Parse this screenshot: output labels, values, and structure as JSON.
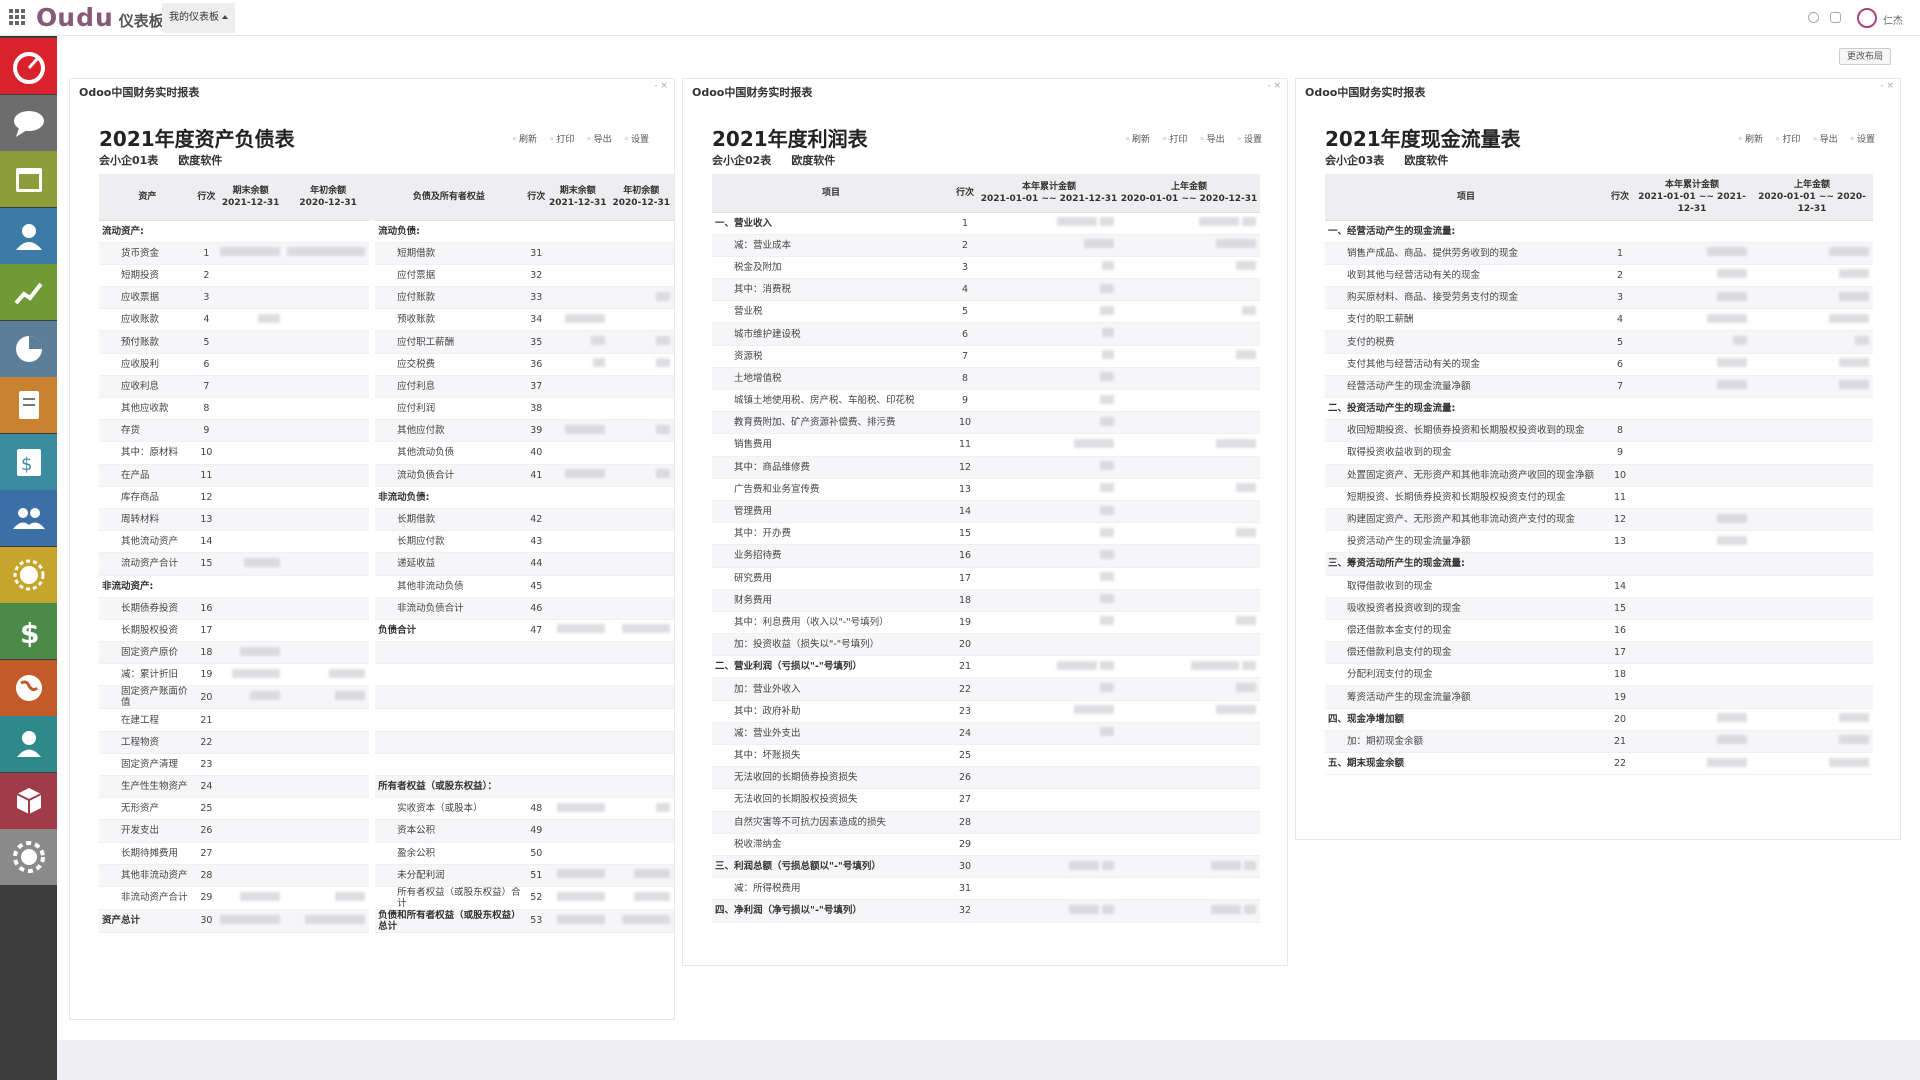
{
  "topbar": {
    "logo_o": "O",
    "logo_rest": "udu",
    "app_name": "仪表板",
    "dashboard_menu": "我的仪表板",
    "user_name": "仁杰"
  },
  "sidebar_icons": [
    "dashboard-icon",
    "chat-icon",
    "calendar-icon",
    "contacts-icon",
    "sales-chart-icon",
    "pie-chart-icon",
    "document-icon",
    "invoice-icon",
    "employees-icon",
    "sun-icon",
    "dollar-icon",
    "website-icon",
    "user-icon",
    "inventory-icon",
    "settings-icon"
  ],
  "layout_button": "更改布局",
  "toolbar": {
    "refresh": "刷新",
    "print": "打印",
    "export": "导出",
    "settings": "设置"
  },
  "balance": {
    "panel_title": "Odoo中国财务实时报表",
    "title": "2021年度资产负债表",
    "code": "会小企01表",
    "company": "欧度软件",
    "headers": {
      "asset": "资产",
      "line": "行次",
      "end": "期末余额",
      "end_date": "2021-12-31",
      "begin": "年初余额",
      "begin_date": "2020-12-31",
      "liab": "负债及所有者权益"
    },
    "rows": [
      {
        "a": "流动资产:",
        "as": true,
        "l": "流动负债:",
        "ls": true
      },
      {
        "a": "货币资金",
        "an": "1",
        "av": [
          60,
          78
        ],
        "l": "短期借款",
        "ln": "31"
      },
      {
        "a": "短期投资",
        "an": "2",
        "l": "应付票据",
        "ln": "32"
      },
      {
        "a": "应收票据",
        "an": "3",
        "l": "应付账款",
        "ln": "33",
        "lv": [
          0,
          14
        ]
      },
      {
        "a": "应收账款",
        "an": "4",
        "av": [
          22,
          0
        ],
        "l": "预收账款",
        "ln": "34",
        "lv": [
          40,
          0
        ]
      },
      {
        "a": "预付账款",
        "an": "5",
        "l": "应付职工薪酬",
        "ln": "35",
        "lv": [
          14,
          14
        ]
      },
      {
        "a": "应收股利",
        "an": "6",
        "l": "应交税费",
        "ln": "36",
        "lv": [
          12,
          14
        ]
      },
      {
        "a": "应收利息",
        "an": "7",
        "l": "应付利息",
        "ln": "37"
      },
      {
        "a": "其他应收款",
        "an": "8",
        "l": "应付利润",
        "ln": "38"
      },
      {
        "a": "存货",
        "an": "9",
        "l": "其他应付款",
        "ln": "39",
        "lv": [
          40,
          14
        ]
      },
      {
        "a": "其中：原材料",
        "an": "10",
        "l": "其他流动负债",
        "ln": "40"
      },
      {
        "a": "在产品",
        "an": "11",
        "l": "流动负债合计",
        "ln": "41",
        "lv": [
          40,
          14
        ]
      },
      {
        "a": "库存商品",
        "an": "12",
        "l": "非流动负债:",
        "ls": true
      },
      {
        "a": "周转材料",
        "an": "13",
        "l": "长期借款",
        "ln": "42"
      },
      {
        "a": "其他流动资产",
        "an": "14",
        "l": "长期应付款",
        "ln": "43"
      },
      {
        "a": "流动资产合计",
        "an": "15",
        "av": [
          36,
          0
        ],
        "l": "递延收益",
        "ln": "44"
      },
      {
        "a": "非流动资产:",
        "as": true,
        "l": "其他非流动负债",
        "ln": "45"
      },
      {
        "a": "长期债券投资",
        "an": "16",
        "l": "非流动负债合计",
        "ln": "46"
      },
      {
        "a": "长期股权投资",
        "an": "17",
        "l": "负债合计",
        "ls": true,
        "ln": "47",
        "lv": [
          48,
          48
        ]
      },
      {
        "a": "固定资产原价",
        "an": "18",
        "av": [
          40,
          0
        ]
      },
      {
        "a": "减：累计折旧",
        "an": "19",
        "av": [
          48,
          36
        ]
      },
      {
        "a": "固定资产账面价值",
        "an": "20",
        "av": [
          30,
          30
        ]
      },
      {
        "a": "在建工程",
        "an": "21"
      },
      {
        "a": "工程物资",
        "an": "22"
      },
      {
        "a": "固定资产清理",
        "an": "23"
      },
      {
        "a": "生产性生物资产",
        "an": "24",
        "l": "所有者权益（或股东权益）：",
        "ls": true
      },
      {
        "a": "无形资产",
        "an": "25",
        "l": "实收资本（或股本）",
        "ln": "48",
        "lv": [
          48,
          14
        ]
      },
      {
        "a": "开发支出",
        "an": "26",
        "l": "资本公积",
        "ln": "49"
      },
      {
        "a": "长期待摊费用",
        "an": "27",
        "l": "盈余公积",
        "ln": "50"
      },
      {
        "a": "其他非流动资产",
        "an": "28",
        "l": "未分配利润",
        "ln": "51",
        "lv": [
          48,
          36
        ]
      },
      {
        "a": "非流动资产合计",
        "an": "29",
        "av": [
          40,
          30
        ],
        "l": "所有者权益（或股东权益）合计",
        "ln": "52",
        "lv": [
          48,
          36
        ]
      },
      {
        "a": "资产总计",
        "as": true,
        "an": "30",
        "av": [
          60,
          60
        ],
        "l": "负债和所有者权益（或股东权益）总计",
        "ls": true,
        "ln": "53",
        "lv": [
          48,
          48
        ]
      }
    ]
  },
  "profit": {
    "panel_title": "Odoo中国财务实时报表",
    "title": "2021年度利润表",
    "code": "会小企02表",
    "company": "欧度软件",
    "headers": {
      "item": "项目",
      "line": "行次",
      "cur": "本年累计金额",
      "cur_range": "2021-01-01 ~~ 2021-12-31",
      "prev": "上年金额",
      "prev_range": "2020-01-01 ~~ 2020-12-31"
    },
    "rows": [
      {
        "t": "一、营业收入",
        "s": true,
        "n": "1",
        "c": [
          40,
          14
        ],
        "p": [
          40,
          14
        ]
      },
      {
        "t": "减：营业成本",
        "n": "2",
        "c": [
          30,
          0
        ],
        "p": [
          40,
          0
        ]
      },
      {
        "t": "税金及附加",
        "n": "3",
        "c": [
          12,
          0
        ],
        "p": [
          0,
          20
        ]
      },
      {
        "t": "其中：消费税",
        "n": "4",
        "c": [
          14,
          0
        ]
      },
      {
        "t": "营业税",
        "n": "5",
        "c": [
          14,
          0
        ],
        "p": [
          0,
          14
        ]
      },
      {
        "t": "城市维护建设税",
        "n": "6",
        "c": [
          12,
          0
        ]
      },
      {
        "t": "资源税",
        "n": "7",
        "c": [
          12,
          0
        ],
        "p": [
          0,
          20
        ]
      },
      {
        "t": "土地增值税",
        "n": "8",
        "c": [
          14,
          0
        ]
      },
      {
        "t": "城镇土地使用税、房产税、车船税、印花税",
        "n": "9",
        "c": [
          14,
          0
        ]
      },
      {
        "t": "教育费附加、矿产资源补偿费、排污费",
        "n": "10",
        "c": [
          14,
          0
        ]
      },
      {
        "t": "销售费用",
        "n": "11",
        "c": [
          40,
          0
        ],
        "p": [
          40,
          0
        ]
      },
      {
        "t": "其中：商品维修费",
        "n": "12",
        "c": [
          14,
          0
        ]
      },
      {
        "t": "广告费和业务宣传费",
        "n": "13",
        "c": [
          14,
          0
        ],
        "p": [
          0,
          20
        ]
      },
      {
        "t": "管理费用",
        "n": "14",
        "c": [
          14,
          0
        ]
      },
      {
        "t": "其中：开办费",
        "n": "15",
        "c": [
          14,
          0
        ],
        "p": [
          0,
          20
        ]
      },
      {
        "t": "业务招待费",
        "n": "16",
        "c": [
          14,
          0
        ]
      },
      {
        "t": "研究费用",
        "n": "17",
        "c": [
          14,
          0
        ]
      },
      {
        "t": "财务费用",
        "n": "18",
        "c": [
          14,
          0
        ]
      },
      {
        "t": "其中：利息费用（收入以\"-\"号填列）",
        "n": "19",
        "c": [
          14,
          0
        ],
        "p": [
          0,
          20
        ]
      },
      {
        "t": "加：投资收益（损失以\"-\"号填列）",
        "n": "20"
      },
      {
        "t": "二、营业利润（亏损以\"-\"号填列）",
        "s": true,
        "n": "21",
        "c": [
          40,
          14
        ],
        "p": [
          48,
          14
        ]
      },
      {
        "t": "加：营业外收入",
        "n": "22",
        "c": [
          14,
          0
        ],
        "p": [
          0,
          20
        ]
      },
      {
        "t": "其中：政府补助",
        "n": "23",
        "c": [
          40,
          0
        ],
        "p": [
          40,
          0
        ]
      },
      {
        "t": "减：营业外支出",
        "n": "24",
        "c": [
          14,
          0
        ]
      },
      {
        "t": "其中：坏账损失",
        "n": "25"
      },
      {
        "t": "无法收回的长期债券投资损失",
        "n": "26"
      },
      {
        "t": "无法收回的长期股权投资损失",
        "n": "27"
      },
      {
        "t": "自然灾害等不可抗力因素造成的损失",
        "n": "28"
      },
      {
        "t": "税收滞纳金",
        "n": "29"
      },
      {
        "t": "三、利润总额（亏损总额以\"-\"号填列）",
        "s": true,
        "n": "30",
        "c": [
          30,
          12
        ],
        "p": [
          30,
          12
        ]
      },
      {
        "t": "减：所得税费用",
        "n": "31"
      },
      {
        "t": "四、净利润（净亏损以\"-\"号填列）",
        "s": true,
        "n": "32",
        "c": [
          30,
          12
        ],
        "p": [
          30,
          12
        ]
      }
    ]
  },
  "cashflow": {
    "panel_title": "Odoo中国财务实时报表",
    "title": "2021年度现金流量表",
    "code": "会小企03表",
    "company": "欧度软件",
    "headers": {
      "item": "项目",
      "line": "行次",
      "cur": "本年累计金额",
      "cur_range": "2021-01-01 ~~ 2021-12-31",
      "prev": "上年金额",
      "prev_range": "2020-01-01 ~~ 2020-12-31"
    },
    "rows": [
      {
        "t": "一、经营活动产生的现金流量:",
        "s": true
      },
      {
        "t": "销售产成品、商品、提供劳务收到的现金",
        "n": "1",
        "c": [
          40,
          0
        ],
        "p": [
          40,
          0
        ]
      },
      {
        "t": "收到其他与经营活动有关的现金",
        "n": "2",
        "c": [
          30,
          0
        ],
        "p": [
          30,
          0
        ]
      },
      {
        "t": "购买原材料、商品、接受劳务支付的现金",
        "n": "3",
        "c": [
          30,
          0
        ],
        "p": [
          30,
          0
        ]
      },
      {
        "t": "支付的职工薪酬",
        "n": "4",
        "c": [
          40,
          0
        ],
        "p": [
          40,
          0
        ]
      },
      {
        "t": "支付的税费",
        "n": "5",
        "c": [
          14,
          0
        ],
        "p": [
          14,
          0
        ]
      },
      {
        "t": "支付其他与经营活动有关的现金",
        "n": "6",
        "c": [
          30,
          0
        ],
        "p": [
          30,
          0
        ]
      },
      {
        "t": "经营活动产生的现金流量净额",
        "n": "7",
        "c": [
          30,
          0
        ],
        "p": [
          30,
          0
        ]
      },
      {
        "t": "二、投资活动产生的现金流量:",
        "s": true
      },
      {
        "t": "收回短期投资、长期债券投资和长期股权投资收到的现金",
        "n": "8"
      },
      {
        "t": "取得投资收益收到的现金",
        "n": "9"
      },
      {
        "t": "处置固定资产、无形资产和其他非流动资产收回的现金净额",
        "n": "10"
      },
      {
        "t": "短期投资、长期债券投资和长期股权投资支付的现金",
        "n": "11"
      },
      {
        "t": "购建固定资产、无形资产和其他非流动资产支付的现金",
        "n": "12",
        "c": [
          30,
          0
        ]
      },
      {
        "t": "投资活动产生的现金流量净额",
        "n": "13",
        "c": [
          30,
          0
        ]
      },
      {
        "t": "三、筹资活动所产生的现金流量:",
        "s": true
      },
      {
        "t": "取得借款收到的现金",
        "n": "14"
      },
      {
        "t": "吸收投资者投资收到的现金",
        "n": "15"
      },
      {
        "t": "偿还借款本金支付的现金",
        "n": "16"
      },
      {
        "t": "偿还借款利息支付的现金",
        "n": "17"
      },
      {
        "t": "分配利润支付的现金",
        "n": "18"
      },
      {
        "t": "筹资活动产生的现金流量净额",
        "n": "19"
      },
      {
        "t": "四、现金净增加额",
        "s": true,
        "n": "20",
        "c": [
          30,
          0
        ],
        "p": [
          30,
          0
        ]
      },
      {
        "t": "加：期初现金余额",
        "n": "21",
        "c": [
          30,
          0
        ],
        "p": [
          30,
          0
        ]
      },
      {
        "t": "五、期末现金余额",
        "s": true,
        "n": "22",
        "c": [
          40,
          0
        ],
        "p": [
          40,
          0
        ]
      }
    ]
  }
}
